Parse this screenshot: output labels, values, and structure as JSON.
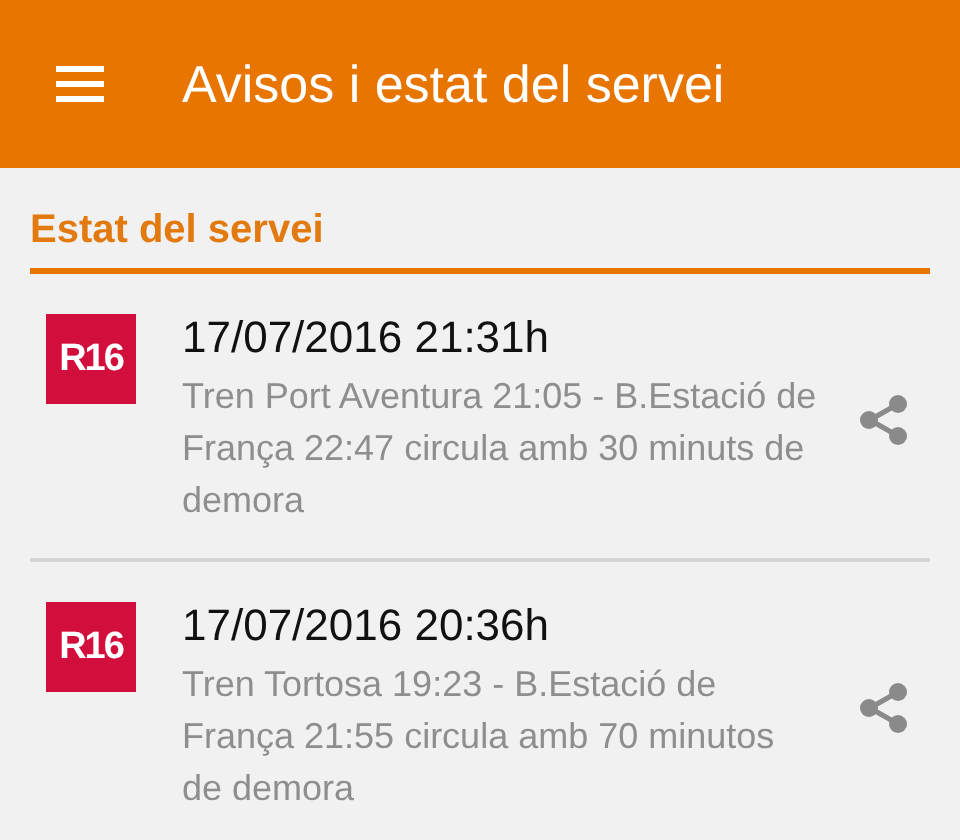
{
  "app_bar": {
    "title": "Avisos i estat del servei"
  },
  "section": {
    "title": "Estat del servei"
  },
  "notices": [
    {
      "line": "R16",
      "color": "#d20f3c",
      "datetime": "17/07/2016 21:31h",
      "message": "Tren Port Aventura 21:05 - B.Estació de França 22:47 circula amb 30 minuts de demora"
    },
    {
      "line": "R16",
      "color": "#d20f3c",
      "datetime": "17/07/2016 20:36h",
      "message": "Tren Tortosa 19:23 - B.Estació de França 21:55 circula amb 70 minutos de demora"
    }
  ]
}
